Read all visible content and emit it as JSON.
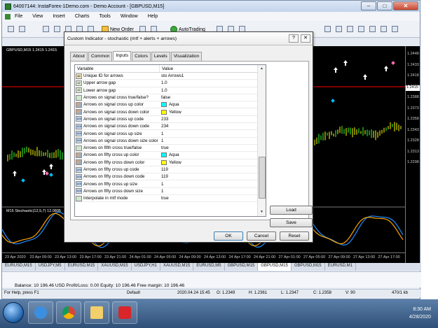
{
  "window": {
    "title": "64007144: InstaForex-1Demo.com - Demo Account - [GBPUSD,M15]",
    "controls": [
      "–",
      "□",
      "✕"
    ]
  },
  "menu": [
    "File",
    "View",
    "Insert",
    "Charts",
    "Tools",
    "Window",
    "Help"
  ],
  "toolbar": {
    "new_order": "New Order",
    "autotrading": "AutoTrading"
  },
  "chart": {
    "label": "GBPUSD,M15  1.2415 1.2415",
    "stoch_label": "M15 Stochastic(12,5,7) 12.0805",
    "price_ticks": [
      "1.2448",
      "1.2433",
      "1.2418",
      "1.2403",
      "1.2388",
      "1.2373",
      "1.2358",
      "1.2343",
      "1.2328",
      "1.2313",
      "1.2298"
    ],
    "current_price": "1.2415",
    "time_ticks": [
      "23 Apr 2020",
      "23 Apr 09:00",
      "23 Apr 13:00",
      "23 Apr 17:00",
      "23 Apr 21:00",
      "24 Apr 01:00",
      "24 Apr 05:00",
      "24 Apr 09:00",
      "24 Apr 13:00",
      "24 Apr 17:00",
      "24 Apr 21:00",
      "27 Apr 01:00",
      "27 Apr 05:00",
      "27 Apr 09:00",
      "27 Apr 13:00",
      "27 Apr 17:00"
    ],
    "colors": {
      "background": "#000000",
      "up_bar": "#33ff33",
      "down_bar": "#ffff00",
      "arrow_up": "#ffffff",
      "arrow_down": "#ff69b4",
      "diamond": "#00bfff",
      "stoch_main": "#1e90ff",
      "stoch_signal": "#ffa500",
      "price_line": "#ff0000"
    }
  },
  "chart_tabs": [
    "EURUSD,M15",
    "USDJPY,M5",
    "EURUSD,M15",
    "XAUUSD,M15",
    "USDJPY,H1",
    "XAUUSD,M15",
    "EURUSD,M5",
    "GBPUSD,M15",
    "GBPUSD,M15",
    "GBPUSD,M15",
    "EURUSD,M1"
  ],
  "account_line": "Balance: 10 196.46 USD  Profit/Loss: 0.00  Equity: 10 196.46  Free margin: 10 196.46",
  "status": {
    "help": "For Help, press F1",
    "profile": "Default",
    "datetime": "2020.04.24 15:45",
    "open": "O: 1.2349",
    "high": "H: 1.2361",
    "low": "L: 1.2347",
    "close": "C: 1.2358",
    "volume": "V: 90",
    "traffic": "470/1 kb"
  },
  "taskbar": {
    "time": "8:30 AM",
    "date": "4/28/2020"
  },
  "dialog": {
    "title": "Custom Indicator - stochastic (mtf + alerts + arrows)",
    "tabs": [
      "About",
      "Common",
      "Inputs",
      "Colors",
      "Levels",
      "Visualization"
    ],
    "active_tab": "Inputs",
    "columns": [
      "Variable",
      "Value"
    ],
    "params": [
      {
        "type": "string",
        "name": "Unique ID for arrows",
        "value": "sto Arrows1"
      },
      {
        "type": "double",
        "name": "Upper arrow gap",
        "value": "1.0"
      },
      {
        "type": "double",
        "name": "Lower arrow gap",
        "value": "1.0"
      },
      {
        "type": "bool",
        "name": "Arrows on signal cross true/false?",
        "value": "false"
      },
      {
        "type": "color",
        "name": "Arrows on signal cross up color",
        "value": "Aqua",
        "swatch": "#00ffff"
      },
      {
        "type": "color",
        "name": "Arrows on signal cross down color",
        "value": "Yellow",
        "swatch": "#ffff00"
      },
      {
        "type": "int",
        "name": "Arrows on signal cross up code",
        "value": "233"
      },
      {
        "type": "int",
        "name": "Arrows on signal cross down code",
        "value": "234"
      },
      {
        "type": "int",
        "name": "Arrows on signal cross up size",
        "value": "1"
      },
      {
        "type": "int",
        "name": "Arrows on signal cross down size color",
        "value": "1"
      },
      {
        "type": "bool",
        "name": "Arrows on fifth cross true/false",
        "value": "true"
      },
      {
        "type": "color",
        "name": "Arrows on fifty cross up color",
        "value": "Aqua",
        "swatch": "#00ffff"
      },
      {
        "type": "color",
        "name": "Arrows on fifty cross down color",
        "value": "Yellow",
        "swatch": "#ffff00"
      },
      {
        "type": "int",
        "name": "Arrows on fifty cross up code",
        "value": "119"
      },
      {
        "type": "int",
        "name": "Arrows on fifty cross down code",
        "value": "119"
      },
      {
        "type": "int",
        "name": "Arrows on fifty cross up size",
        "value": "1"
      },
      {
        "type": "int",
        "name": "Arrows on fifty cross down size",
        "value": "1"
      },
      {
        "type": "bool",
        "name": "Interpolate in mtf mode",
        "value": "true"
      }
    ],
    "type_icon_text": {
      "string": "ab",
      "double": "v2",
      "bool": "",
      "color": "",
      "int": "123"
    },
    "load_button": "Load",
    "save_button": "Save",
    "ok_button": "OK",
    "cancel_button": "Cancel",
    "reset_button": "Reset"
  }
}
